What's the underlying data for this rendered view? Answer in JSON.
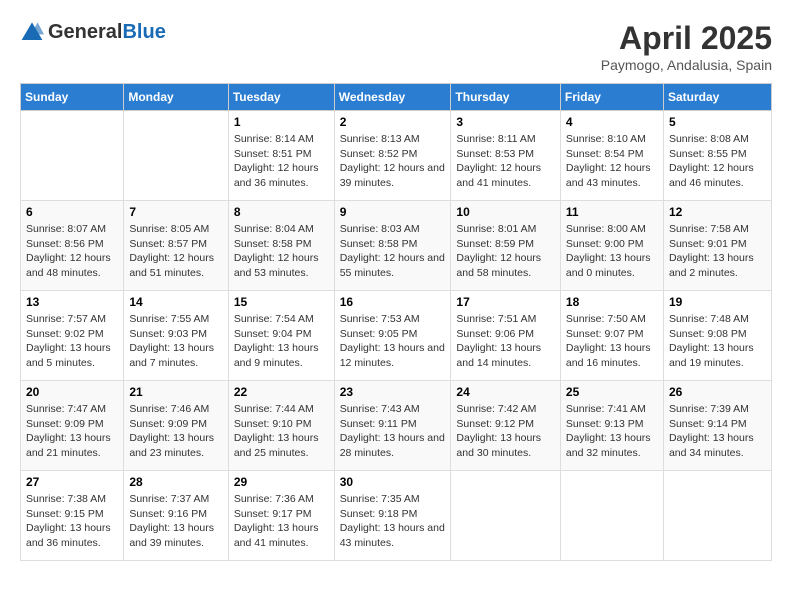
{
  "logo": {
    "general": "General",
    "blue": "Blue"
  },
  "title": "April 2025",
  "subtitle": "Paymogo, Andalusia, Spain",
  "days_of_week": [
    "Sunday",
    "Monday",
    "Tuesday",
    "Wednesday",
    "Thursday",
    "Friday",
    "Saturday"
  ],
  "weeks": [
    [
      {
        "day": "",
        "info": ""
      },
      {
        "day": "",
        "info": ""
      },
      {
        "day": "1",
        "sunrise": "8:14 AM",
        "sunset": "8:51 PM",
        "daylight": "12 hours and 36 minutes."
      },
      {
        "day": "2",
        "sunrise": "8:13 AM",
        "sunset": "8:52 PM",
        "daylight": "12 hours and 39 minutes."
      },
      {
        "day": "3",
        "sunrise": "8:11 AM",
        "sunset": "8:53 PM",
        "daylight": "12 hours and 41 minutes."
      },
      {
        "day": "4",
        "sunrise": "8:10 AM",
        "sunset": "8:54 PM",
        "daylight": "12 hours and 43 minutes."
      },
      {
        "day": "5",
        "sunrise": "8:08 AM",
        "sunset": "8:55 PM",
        "daylight": "12 hours and 46 minutes."
      }
    ],
    [
      {
        "day": "6",
        "sunrise": "8:07 AM",
        "sunset": "8:56 PM",
        "daylight": "12 hours and 48 minutes."
      },
      {
        "day": "7",
        "sunrise": "8:05 AM",
        "sunset": "8:57 PM",
        "daylight": "12 hours and 51 minutes."
      },
      {
        "day": "8",
        "sunrise": "8:04 AM",
        "sunset": "8:58 PM",
        "daylight": "12 hours and 53 minutes."
      },
      {
        "day": "9",
        "sunrise": "8:03 AM",
        "sunset": "8:58 PM",
        "daylight": "12 hours and 55 minutes."
      },
      {
        "day": "10",
        "sunrise": "8:01 AM",
        "sunset": "8:59 PM",
        "daylight": "12 hours and 58 minutes."
      },
      {
        "day": "11",
        "sunrise": "8:00 AM",
        "sunset": "9:00 PM",
        "daylight": "13 hours and 0 minutes."
      },
      {
        "day": "12",
        "sunrise": "7:58 AM",
        "sunset": "9:01 PM",
        "daylight": "13 hours and 2 minutes."
      }
    ],
    [
      {
        "day": "13",
        "sunrise": "7:57 AM",
        "sunset": "9:02 PM",
        "daylight": "13 hours and 5 minutes."
      },
      {
        "day": "14",
        "sunrise": "7:55 AM",
        "sunset": "9:03 PM",
        "daylight": "13 hours and 7 minutes."
      },
      {
        "day": "15",
        "sunrise": "7:54 AM",
        "sunset": "9:04 PM",
        "daylight": "13 hours and 9 minutes."
      },
      {
        "day": "16",
        "sunrise": "7:53 AM",
        "sunset": "9:05 PM",
        "daylight": "13 hours and 12 minutes."
      },
      {
        "day": "17",
        "sunrise": "7:51 AM",
        "sunset": "9:06 PM",
        "daylight": "13 hours and 14 minutes."
      },
      {
        "day": "18",
        "sunrise": "7:50 AM",
        "sunset": "9:07 PM",
        "daylight": "13 hours and 16 minutes."
      },
      {
        "day": "19",
        "sunrise": "7:48 AM",
        "sunset": "9:08 PM",
        "daylight": "13 hours and 19 minutes."
      }
    ],
    [
      {
        "day": "20",
        "sunrise": "7:47 AM",
        "sunset": "9:09 PM",
        "daylight": "13 hours and 21 minutes."
      },
      {
        "day": "21",
        "sunrise": "7:46 AM",
        "sunset": "9:09 PM",
        "daylight": "13 hours and 23 minutes."
      },
      {
        "day": "22",
        "sunrise": "7:44 AM",
        "sunset": "9:10 PM",
        "daylight": "13 hours and 25 minutes."
      },
      {
        "day": "23",
        "sunrise": "7:43 AM",
        "sunset": "9:11 PM",
        "daylight": "13 hours and 28 minutes."
      },
      {
        "day": "24",
        "sunrise": "7:42 AM",
        "sunset": "9:12 PM",
        "daylight": "13 hours and 30 minutes."
      },
      {
        "day": "25",
        "sunrise": "7:41 AM",
        "sunset": "9:13 PM",
        "daylight": "13 hours and 32 minutes."
      },
      {
        "day": "26",
        "sunrise": "7:39 AM",
        "sunset": "9:14 PM",
        "daylight": "13 hours and 34 minutes."
      }
    ],
    [
      {
        "day": "27",
        "sunrise": "7:38 AM",
        "sunset": "9:15 PM",
        "daylight": "13 hours and 36 minutes."
      },
      {
        "day": "28",
        "sunrise": "7:37 AM",
        "sunset": "9:16 PM",
        "daylight": "13 hours and 39 minutes."
      },
      {
        "day": "29",
        "sunrise": "7:36 AM",
        "sunset": "9:17 PM",
        "daylight": "13 hours and 41 minutes."
      },
      {
        "day": "30",
        "sunrise": "7:35 AM",
        "sunset": "9:18 PM",
        "daylight": "13 hours and 43 minutes."
      },
      {
        "day": "",
        "info": ""
      },
      {
        "day": "",
        "info": ""
      },
      {
        "day": "",
        "info": ""
      }
    ]
  ],
  "labels": {
    "sunrise": "Sunrise:",
    "sunset": "Sunset:",
    "daylight": "Daylight:"
  }
}
